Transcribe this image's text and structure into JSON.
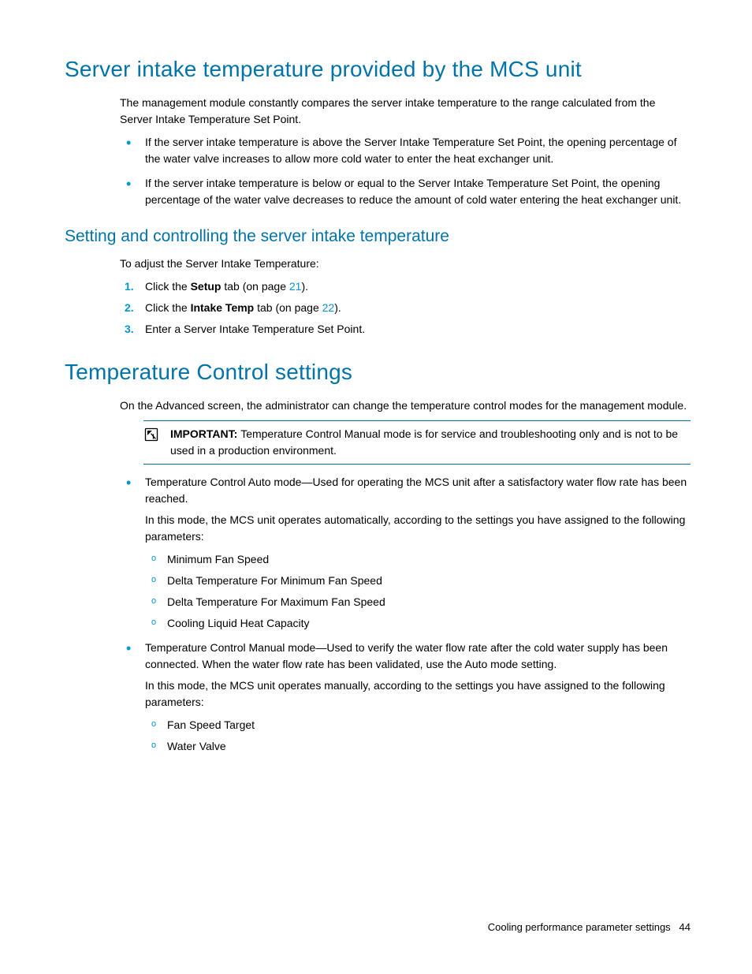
{
  "section1": {
    "heading": "Server intake temperature provided by the MCS unit",
    "intro": "The management module constantly compares the server intake temperature to the range calculated from the Server Intake Temperature Set Point.",
    "bullet1": "If the server intake temperature is above the Server Intake Temperature Set Point, the opening percentage of the water valve increases to allow more cold water to enter the heat exchanger unit.",
    "bullet2": "If the server intake temperature is below or equal to the Server Intake Temperature Set Point, the opening percentage of the water valve decreases to reduce the amount of cold water entering the heat exchanger unit."
  },
  "section2": {
    "heading": "Setting and controlling the server intake temperature",
    "intro": "To adjust the Server Intake Temperature:",
    "step1_pre": "Click the ",
    "step1_bold": "Setup",
    "step1_mid": " tab (on page ",
    "step1_link": "21",
    "step1_end": ").",
    "step2_pre": "Click the ",
    "step2_bold": "Intake Temp",
    "step2_mid": " tab (on page ",
    "step2_link": "22",
    "step2_end": ").",
    "step3": "Enter a Server Intake Temperature Set Point."
  },
  "section3": {
    "heading": "Temperature Control settings",
    "intro": "On the Advanced screen, the administrator can change the temperature control modes for the management module.",
    "important_label": "IMPORTANT:   ",
    "important_text": "Temperature Control Manual mode is for service and troubleshooting only and is not to be used in a production environment.",
    "bullet1_text": "Temperature Control Auto mode—Used for operating the MCS unit after a satisfactory water flow rate has been reached.",
    "bullet1_para": "In this mode, the MCS unit operates automatically, according to the settings you have assigned to the following parameters:",
    "sub1a": "Minimum Fan Speed",
    "sub1b": "Delta Temperature For Minimum Fan Speed",
    "sub1c": "Delta Temperature For Maximum Fan Speed",
    "sub1d": "Cooling Liquid Heat Capacity",
    "bullet2_text": "Temperature Control Manual mode—Used to verify the water flow rate after the cold water supply has been connected. When the water flow rate has been validated, use the Auto mode setting.",
    "bullet2_para": "In this mode, the MCS unit operates manually, according to the settings you have assigned to the following parameters:",
    "sub2a": "Fan Speed Target",
    "sub2b": "Water Valve"
  },
  "footer": {
    "section": "Cooling performance parameter settings",
    "page": "44"
  }
}
